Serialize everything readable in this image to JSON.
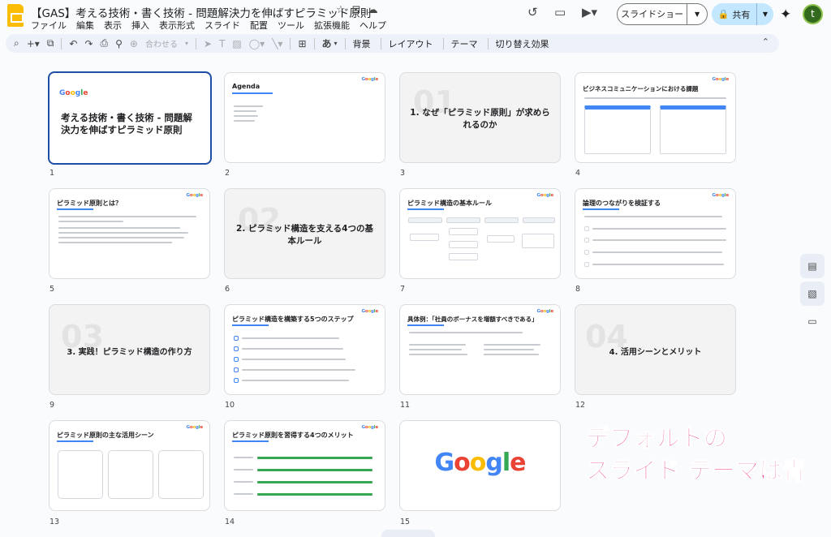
{
  "doc": {
    "title": "【GAS】考える技術・書く技術 - 問題解決力を伸ばすピラミッド原則",
    "menu": [
      "ファイル",
      "編集",
      "表示",
      "挿入",
      "表示形式",
      "スライド",
      "配置",
      "ツール",
      "拡張機能",
      "ヘルプ"
    ]
  },
  "header": {
    "slideshow_label": "スライドショー",
    "share_label": "共有",
    "avatar_letter": "t"
  },
  "toolbar": {
    "zoom_label": "合わせる",
    "font_label": "あ",
    "buttons": [
      "背景",
      "レイアウト",
      "テーマ",
      "切り替え効果"
    ]
  },
  "slides": [
    {
      "num": "1",
      "title": "考える技術・書く技術 - 問題解決力を伸ばすピラミッド原則"
    },
    {
      "num": "2",
      "title": "Agenda"
    },
    {
      "num": "3",
      "title": "1. なぜ「ピラミッド原則」が求められるのか",
      "ghost": "01"
    },
    {
      "num": "4",
      "title": "ビジネスコミュニケーションにおける課題"
    },
    {
      "num": "5",
      "title": "ピラミッド原則とは？"
    },
    {
      "num": "6",
      "title": "2. ピラミッド構造を支える4つの基本ルール",
      "ghost": "02"
    },
    {
      "num": "7",
      "title": "ピラミッド構造の基本ルール"
    },
    {
      "num": "8",
      "title": "論理のつながりを検証する"
    },
    {
      "num": "9",
      "title": "3. 実践！ピラミッド構造の作り方",
      "ghost": "03"
    },
    {
      "num": "10",
      "title": "ピラミッド構造を構築する5つのステップ"
    },
    {
      "num": "11",
      "title": "具体例：「社員のボーナスを増額すべきである」"
    },
    {
      "num": "12",
      "title": "4. 活用シーンとメリット",
      "ghost": "04"
    },
    {
      "num": "13",
      "title": "ピラミッド原則の主な活用シーン"
    },
    {
      "num": "14",
      "title": "ピラミッド原則を習得する4つのメリット"
    },
    {
      "num": "15",
      "title": "Google"
    }
  ],
  "annotation": {
    "line1": "デフォルトの",
    "line2": "スライド テーマは青"
  },
  "colors": {
    "accent": "#4285f4",
    "annotation": "#e8308a",
    "share_bg": "#c2e7ff",
    "selected_border": "#1f4fa5"
  }
}
